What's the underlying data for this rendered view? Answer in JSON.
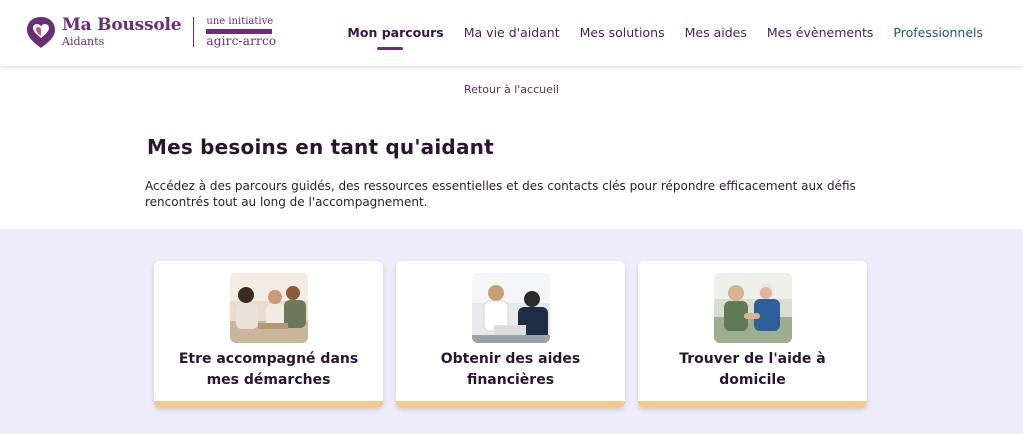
{
  "brand": {
    "name": "Ma Boussole",
    "tagline": "Aidants",
    "partner_intro": "une initiative",
    "partner_name": "agirc-arrco"
  },
  "nav": {
    "items": [
      {
        "label": "Mon parcours",
        "active": true
      },
      {
        "label": "Ma vie d'aidant"
      },
      {
        "label": "Mes solutions"
      },
      {
        "label": "Mes aides"
      },
      {
        "label": "Mes évènements"
      },
      {
        "label": "Professionnels"
      }
    ]
  },
  "back_link": "Retour à l'accueil",
  "page": {
    "title": "Mes besoins en tant qu'aidant",
    "description": "Accédez à des parcours guidés, des ressources essentielles et des contacts clés pour répondre efficacement aux défis rencontrés tout au long de l'accompagnement."
  },
  "cards": [
    {
      "label": "Etre accompagné dans mes démarches"
    },
    {
      "label": "Obtenir des aides financières"
    },
    {
      "label": "Trouver de l'aide à domicile"
    }
  ],
  "colors": {
    "brand_purple": "#6b2d73",
    "card_accent": "#f3c98e",
    "section_bg": "#efedfb"
  }
}
